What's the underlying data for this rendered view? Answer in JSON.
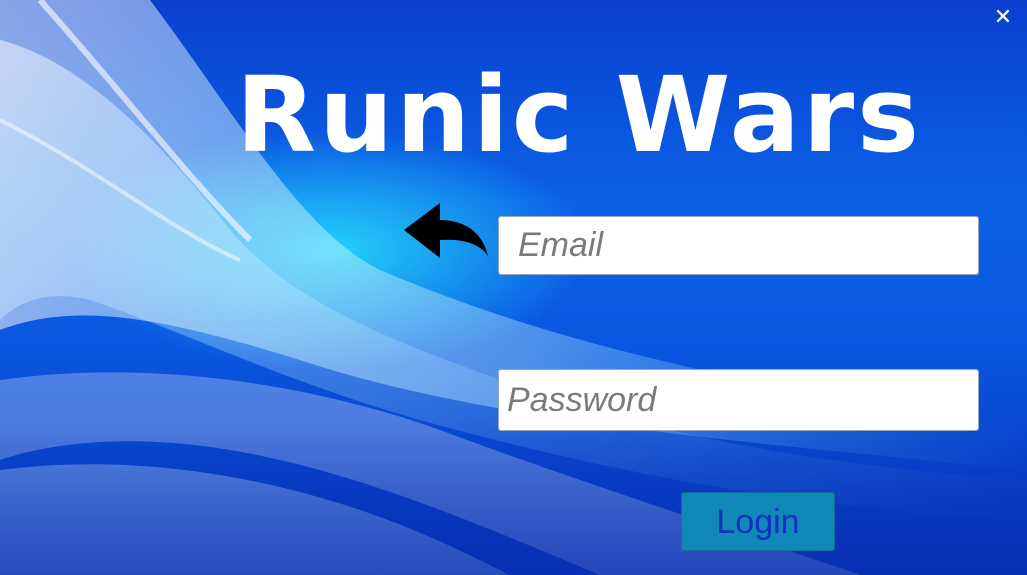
{
  "window": {
    "close_label": "✕"
  },
  "game": {
    "title": "Runic Wars"
  },
  "login_form": {
    "email_placeholder": "Email",
    "email_value": "",
    "password_placeholder": "Password",
    "password_value": "",
    "login_label": "Login"
  },
  "icons": {
    "back": "back-arrow-icon",
    "close": "close-icon"
  },
  "colors": {
    "background_primary": "#0a56e0",
    "background_glow": "#28e6ff",
    "title_text": "#ffffff",
    "login_button_bg": "#1288b8",
    "login_button_text": "#1330c4"
  }
}
